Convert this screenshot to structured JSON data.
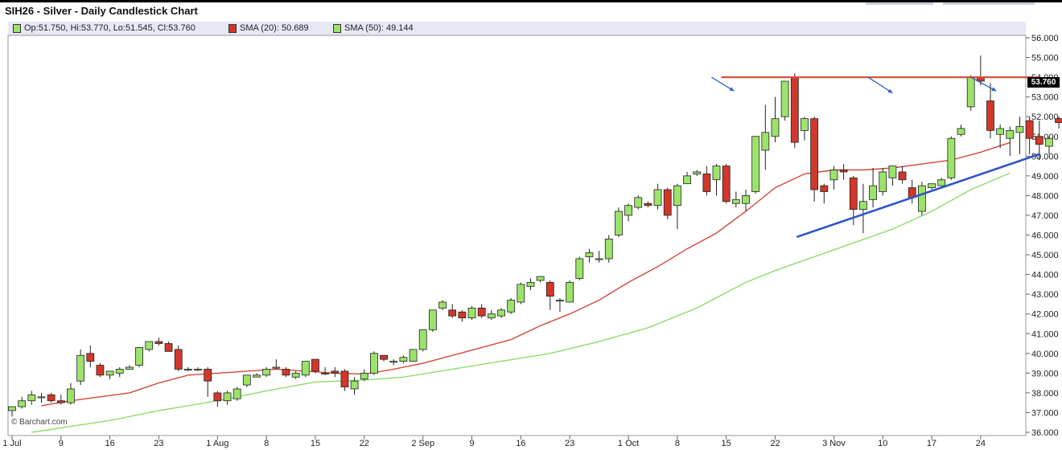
{
  "title": "SIH26 - Silver - Daily Candlestick Chart",
  "legend": {
    "ohlc": "Op:51.750, Hi:53.770, Lo:51.545, Cl:53.760",
    "sma20": "SMA (20): 50.689",
    "sma50": "SMA (50): 49.144"
  },
  "credit": "© Barchart.com",
  "last_price_tag": "53.760",
  "colors": {
    "up": "#9be36a",
    "down": "#d2372b",
    "sma20": "#d24a3a",
    "sma50": "#8edb6a",
    "resistance": "#d2553c",
    "trendline": "#2f55c8",
    "arrow": "#2f5fc0",
    "legend_bg": "#e6e8f6"
  },
  "chart_data": {
    "type": "candlestick",
    "title": "SIH26 - Silver - Daily Candlestick Chart",
    "y_tick_labels": [
      "56.000",
      "55.000",
      "54.000",
      "53.000",
      "52.000",
      "51.000",
      "50.000",
      "49.000",
      "48.000",
      "47.000",
      "46.000",
      "45.000",
      "44.000",
      "43.000",
      "42.000",
      "41.000",
      "40.000",
      "39.000",
      "38.000",
      "37.000",
      "36.000"
    ],
    "y_ticks": [
      56,
      55,
      54,
      53,
      52,
      51,
      50,
      49,
      48,
      47,
      46,
      45,
      44,
      43,
      42,
      41,
      40,
      39,
      38,
      37,
      36
    ],
    "ylim": [
      36,
      56.3
    ],
    "x_labels": [
      {
        "i": 0,
        "label": "1 Jul"
      },
      {
        "i": 5,
        "label": "9"
      },
      {
        "i": 10,
        "label": "16"
      },
      {
        "i": 15,
        "label": "23"
      },
      {
        "i": 21,
        "label": "1 Aug"
      },
      {
        "i": 26,
        "label": "8"
      },
      {
        "i": 31,
        "label": "15"
      },
      {
        "i": 36,
        "label": "22"
      },
      {
        "i": 42,
        "label": "2 Sep"
      },
      {
        "i": 47,
        "label": "9"
      },
      {
        "i": 52,
        "label": "16"
      },
      {
        "i": 57,
        "label": "23"
      },
      {
        "i": 63,
        "label": "1 Oct"
      },
      {
        "i": 68,
        "label": "8"
      },
      {
        "i": 73,
        "label": "15"
      },
      {
        "i": 78,
        "label": "22"
      },
      {
        "i": 84,
        "label": "3 Nov"
      },
      {
        "i": 89,
        "label": "10"
      },
      {
        "i": 94,
        "label": "17"
      },
      {
        "i": 99,
        "label": "24"
      }
    ],
    "candles": [
      {
        "o": 37.1,
        "h": 37.3,
        "l": 36.8,
        "c": 37.3
      },
      {
        "o": 37.3,
        "h": 37.8,
        "l": 37.2,
        "c": 37.6
      },
      {
        "o": 37.6,
        "h": 38.1,
        "l": 37.4,
        "c": 37.9
      },
      {
        "o": 37.8,
        "h": 38.0,
        "l": 37.5,
        "c": 37.8
      },
      {
        "o": 37.9,
        "h": 38.0,
        "l": 37.5,
        "c": 37.6
      },
      {
        "o": 37.6,
        "h": 37.9,
        "l": 37.4,
        "c": 37.5
      },
      {
        "o": 37.5,
        "h": 38.5,
        "l": 37.4,
        "c": 38.2
      },
      {
        "o": 38.6,
        "h": 40.2,
        "l": 38.4,
        "c": 39.9
      },
      {
        "o": 40.0,
        "h": 40.4,
        "l": 39.3,
        "c": 39.6
      },
      {
        "o": 39.4,
        "h": 39.5,
        "l": 38.8,
        "c": 38.9
      },
      {
        "o": 38.9,
        "h": 39.1,
        "l": 38.7,
        "c": 39.1
      },
      {
        "o": 39.0,
        "h": 39.3,
        "l": 38.8,
        "c": 39.2
      },
      {
        "o": 39.2,
        "h": 39.4,
        "l": 39.2,
        "c": 39.3
      },
      {
        "o": 39.4,
        "h": 40.3,
        "l": 39.3,
        "c": 40.3
      },
      {
        "o": 40.2,
        "h": 40.6,
        "l": 40.1,
        "c": 40.6
      },
      {
        "o": 40.6,
        "h": 40.8,
        "l": 40.4,
        "c": 40.5
      },
      {
        "o": 40.5,
        "h": 40.6,
        "l": 40.1,
        "c": 40.1
      },
      {
        "o": 40.2,
        "h": 40.4,
        "l": 39.1,
        "c": 39.2
      },
      {
        "o": 39.2,
        "h": 39.3,
        "l": 39.1,
        "c": 39.2
      },
      {
        "o": 39.2,
        "h": 39.3,
        "l": 39.1,
        "c": 39.2
      },
      {
        "o": 39.2,
        "h": 39.3,
        "l": 37.8,
        "c": 38.6
      },
      {
        "o": 38.0,
        "h": 38.1,
        "l": 37.3,
        "c": 37.6
      },
      {
        "o": 37.6,
        "h": 38.1,
        "l": 37.4,
        "c": 38.0
      },
      {
        "o": 37.7,
        "h": 38.3,
        "l": 37.6,
        "c": 38.2
      },
      {
        "o": 38.4,
        "h": 38.9,
        "l": 38.3,
        "c": 38.9
      },
      {
        "o": 38.8,
        "h": 39.0,
        "l": 38.8,
        "c": 38.9
      },
      {
        "o": 38.9,
        "h": 39.3,
        "l": 38.8,
        "c": 39.2
      },
      {
        "o": 39.3,
        "h": 39.7,
        "l": 39.2,
        "c": 39.3
      },
      {
        "o": 39.2,
        "h": 39.3,
        "l": 38.8,
        "c": 38.9
      },
      {
        "o": 38.8,
        "h": 39.1,
        "l": 38.7,
        "c": 39.0
      },
      {
        "o": 38.9,
        "h": 39.6,
        "l": 38.8,
        "c": 39.6
      },
      {
        "o": 39.7,
        "h": 39.7,
        "l": 39.0,
        "c": 39.1
      },
      {
        "o": 39.0,
        "h": 39.3,
        "l": 38.9,
        "c": 39.0
      },
      {
        "o": 39.1,
        "h": 39.3,
        "l": 38.8,
        "c": 39.0
      },
      {
        "o": 39.1,
        "h": 39.2,
        "l": 38.1,
        "c": 38.3
      },
      {
        "o": 38.2,
        "h": 38.8,
        "l": 37.9,
        "c": 38.6
      },
      {
        "o": 38.7,
        "h": 39.2,
        "l": 38.6,
        "c": 39.0
      },
      {
        "o": 39.0,
        "h": 40.1,
        "l": 38.9,
        "c": 40.0
      },
      {
        "o": 39.9,
        "h": 39.9,
        "l": 39.6,
        "c": 39.7
      },
      {
        "o": 39.6,
        "h": 39.7,
        "l": 39.4,
        "c": 39.6
      },
      {
        "o": 39.6,
        "h": 39.9,
        "l": 39.5,
        "c": 39.8
      },
      {
        "o": 39.6,
        "h": 40.2,
        "l": 39.6,
        "c": 40.2
      },
      {
        "o": 40.2,
        "h": 41.2,
        "l": 40.1,
        "c": 41.2
      },
      {
        "o": 41.2,
        "h": 42.2,
        "l": 41.1,
        "c": 42.2
      },
      {
        "o": 42.3,
        "h": 42.7,
        "l": 42.2,
        "c": 42.6
      },
      {
        "o": 42.2,
        "h": 42.5,
        "l": 41.8,
        "c": 41.9
      },
      {
        "o": 42.1,
        "h": 42.2,
        "l": 41.6,
        "c": 41.8
      },
      {
        "o": 41.8,
        "h": 42.4,
        "l": 41.7,
        "c": 42.3
      },
      {
        "o": 42.3,
        "h": 42.5,
        "l": 41.8,
        "c": 41.9
      },
      {
        "o": 41.8,
        "h": 42.2,
        "l": 41.7,
        "c": 42.0
      },
      {
        "o": 41.9,
        "h": 42.3,
        "l": 41.8,
        "c": 42.2
      },
      {
        "o": 42.1,
        "h": 42.8,
        "l": 42.0,
        "c": 42.7
      },
      {
        "o": 42.6,
        "h": 43.6,
        "l": 42.5,
        "c": 43.5
      },
      {
        "o": 43.4,
        "h": 43.8,
        "l": 43.2,
        "c": 43.6
      },
      {
        "o": 43.7,
        "h": 43.9,
        "l": 43.6,
        "c": 43.9
      },
      {
        "o": 43.6,
        "h": 43.7,
        "l": 42.2,
        "c": 42.9
      },
      {
        "o": 42.7,
        "h": 42.8,
        "l": 42.1,
        "c": 42.7
      },
      {
        "o": 42.6,
        "h": 43.7,
        "l": 42.6,
        "c": 43.6
      },
      {
        "o": 43.8,
        "h": 44.9,
        "l": 43.7,
        "c": 44.8
      },
      {
        "o": 44.9,
        "h": 45.3,
        "l": 44.6,
        "c": 45.1
      },
      {
        "o": 44.8,
        "h": 45.2,
        "l": 44.6,
        "c": 44.8
      },
      {
        "o": 44.8,
        "h": 46.0,
        "l": 44.6,
        "c": 45.8
      },
      {
        "o": 46.0,
        "h": 47.4,
        "l": 45.9,
        "c": 47.2
      },
      {
        "o": 47.0,
        "h": 47.6,
        "l": 46.7,
        "c": 47.5
      },
      {
        "o": 47.4,
        "h": 48.0,
        "l": 47.3,
        "c": 47.9
      },
      {
        "o": 47.6,
        "h": 47.7,
        "l": 47.4,
        "c": 47.5
      },
      {
        "o": 47.5,
        "h": 48.6,
        "l": 47.3,
        "c": 48.3
      },
      {
        "o": 48.3,
        "h": 48.4,
        "l": 46.8,
        "c": 47.0
      },
      {
        "o": 47.5,
        "h": 48.6,
        "l": 46.3,
        "c": 48.5
      },
      {
        "o": 48.6,
        "h": 49.2,
        "l": 48.6,
        "c": 49.0
      },
      {
        "o": 49.1,
        "h": 49.3,
        "l": 49.0,
        "c": 49.2
      },
      {
        "o": 49.1,
        "h": 49.5,
        "l": 48.0,
        "c": 48.2
      },
      {
        "o": 48.8,
        "h": 49.6,
        "l": 48.0,
        "c": 49.5
      },
      {
        "o": 49.5,
        "h": 49.6,
        "l": 47.6,
        "c": 47.7
      },
      {
        "o": 47.6,
        "h": 48.2,
        "l": 47.4,
        "c": 47.8
      },
      {
        "o": 47.6,
        "h": 48.3,
        "l": 47.2,
        "c": 48.0
      },
      {
        "o": 48.2,
        "h": 51.0,
        "l": 48.1,
        "c": 51.0
      },
      {
        "o": 50.3,
        "h": 52.6,
        "l": 49.3,
        "c": 51.2
      },
      {
        "o": 51.0,
        "h": 53.0,
        "l": 50.7,
        "c": 51.9
      },
      {
        "o": 52.0,
        "h": 53.8,
        "l": 51.8,
        "c": 53.8
      },
      {
        "o": 54.0,
        "h": 54.2,
        "l": 50.4,
        "c": 50.7
      },
      {
        "o": 51.3,
        "h": 52.0,
        "l": 50.8,
        "c": 51.9
      },
      {
        "o": 51.9,
        "h": 52.0,
        "l": 47.7,
        "c": 48.3
      },
      {
        "o": 48.5,
        "h": 48.6,
        "l": 47.6,
        "c": 48.2
      },
      {
        "o": 48.8,
        "h": 49.5,
        "l": 48.3,
        "c": 49.3
      },
      {
        "o": 49.3,
        "h": 49.6,
        "l": 48.8,
        "c": 49.2
      },
      {
        "o": 48.9,
        "h": 49.0,
        "l": 46.5,
        "c": 47.3
      },
      {
        "o": 47.3,
        "h": 48.6,
        "l": 46.1,
        "c": 47.7
      },
      {
        "o": 47.8,
        "h": 49.4,
        "l": 47.4,
        "c": 48.5
      },
      {
        "o": 48.2,
        "h": 49.4,
        "l": 48.0,
        "c": 49.2
      },
      {
        "o": 48.9,
        "h": 49.4,
        "l": 48.5,
        "c": 49.5
      },
      {
        "o": 49.2,
        "h": 49.5,
        "l": 48.6,
        "c": 48.8
      },
      {
        "o": 48.4,
        "h": 48.8,
        "l": 47.6,
        "c": 47.9
      },
      {
        "o": 47.2,
        "h": 48.7,
        "l": 47.0,
        "c": 48.5
      },
      {
        "o": 48.4,
        "h": 48.6,
        "l": 48.3,
        "c": 48.6
      },
      {
        "o": 48.5,
        "h": 48.9,
        "l": 48.5,
        "c": 48.8
      },
      {
        "o": 48.9,
        "h": 51.0,
        "l": 48.8,
        "c": 50.9
      },
      {
        "o": 51.1,
        "h": 51.6,
        "l": 51.0,
        "c": 51.4
      },
      {
        "o": 52.5,
        "h": 54.1,
        "l": 52.3,
        "c": 54.0
      },
      {
        "o": 54.0,
        "h": 55.1,
        "l": 53.6,
        "c": 53.8
      },
      {
        "o": 52.8,
        "h": 53.7,
        "l": 50.9,
        "c": 51.3
      },
      {
        "o": 51.1,
        "h": 51.6,
        "l": 50.4,
        "c": 51.4
      },
      {
        "o": 50.9,
        "h": 51.5,
        "l": 50.0,
        "c": 51.3
      },
      {
        "o": 51.2,
        "h": 52.0,
        "l": 50.1,
        "c": 51.5
      },
      {
        "o": 51.8,
        "h": 52.0,
        "l": 50.1,
        "c": 50.9
      },
      {
        "o": 51.0,
        "h": 51.8,
        "l": 49.8,
        "c": 50.6
      },
      {
        "o": 50.5,
        "h": 51.0,
        "l": 50.1,
        "c": 50.9
      },
      {
        "o": 51.9,
        "h": 52.0,
        "l": 51.4,
        "c": 51.7
      },
      {
        "o": 51.75,
        "h": 53.77,
        "l": 51.545,
        "c": 53.76
      }
    ],
    "sma20": [
      {
        "i": 3,
        "v": 37.35
      },
      {
        "i": 6,
        "v": 37.6
      },
      {
        "i": 9,
        "v": 37.8
      },
      {
        "i": 12,
        "v": 38.0
      },
      {
        "i": 15,
        "v": 38.5
      },
      {
        "i": 18,
        "v": 38.9
      },
      {
        "i": 21,
        "v": 39.0
      },
      {
        "i": 24,
        "v": 39.1
      },
      {
        "i": 27,
        "v": 39.2
      },
      {
        "i": 30,
        "v": 39.1
      },
      {
        "i": 33,
        "v": 39.0
      },
      {
        "i": 36,
        "v": 38.95
      },
      {
        "i": 39,
        "v": 39.2
      },
      {
        "i": 42,
        "v": 39.5
      },
      {
        "i": 45,
        "v": 39.9
      },
      {
        "i": 48,
        "v": 40.3
      },
      {
        "i": 51,
        "v": 40.7
      },
      {
        "i": 54,
        "v": 41.4
      },
      {
        "i": 57,
        "v": 42.0
      },
      {
        "i": 60,
        "v": 42.7
      },
      {
        "i": 63,
        "v": 43.6
      },
      {
        "i": 66,
        "v": 44.4
      },
      {
        "i": 69,
        "v": 45.3
      },
      {
        "i": 72,
        "v": 46.1
      },
      {
        "i": 75,
        "v": 47.2
      },
      {
        "i": 78,
        "v": 48.4
      },
      {
        "i": 81,
        "v": 49.1
      },
      {
        "i": 84,
        "v": 49.3
      },
      {
        "i": 87,
        "v": 49.3
      },
      {
        "i": 90,
        "v": 49.4
      },
      {
        "i": 93,
        "v": 49.6
      },
      {
        "i": 96,
        "v": 49.8
      },
      {
        "i": 99,
        "v": 50.2
      },
      {
        "i": 102,
        "v": 50.69
      }
    ],
    "sma50": [
      {
        "i": 2,
        "v": 36.0
      },
      {
        "i": 6,
        "v": 36.3
      },
      {
        "i": 10,
        "v": 36.6
      },
      {
        "i": 15,
        "v": 37.1
      },
      {
        "i": 21,
        "v": 37.6
      },
      {
        "i": 26,
        "v": 38.1
      },
      {
        "i": 31,
        "v": 38.55
      },
      {
        "i": 36,
        "v": 38.65
      },
      {
        "i": 40,
        "v": 38.8
      },
      {
        "i": 45,
        "v": 39.2
      },
      {
        "i": 50,
        "v": 39.6
      },
      {
        "i": 55,
        "v": 40.0
      },
      {
        "i": 60,
        "v": 40.6
      },
      {
        "i": 65,
        "v": 41.3
      },
      {
        "i": 70,
        "v": 42.3
      },
      {
        "i": 75,
        "v": 43.6
      },
      {
        "i": 78,
        "v": 44.2
      },
      {
        "i": 82,
        "v": 44.9
      },
      {
        "i": 86,
        "v": 45.6
      },
      {
        "i": 90,
        "v": 46.3
      },
      {
        "i": 94,
        "v": 47.2
      },
      {
        "i": 98,
        "v": 48.3
      },
      {
        "i": 102,
        "v": 49.14
      }
    ],
    "annotations": {
      "resistance_y": 54.0,
      "resistance_range_i": [
        72.5,
        105
      ],
      "trendline": [
        {
          "i": 80.2,
          "v": 45.9
        },
        {
          "i": 105,
          "v": 50.1
        }
      ],
      "arrows": [
        {
          "from": {
            "i": 71.5,
            "v": 54.0
          },
          "to": {
            "i": 73.8,
            "v": 53.3
          }
        },
        {
          "from": {
            "i": 87.5,
            "v": 54.0
          },
          "to": {
            "i": 90.0,
            "v": 53.2
          }
        },
        {
          "from": {
            "i": 98.0,
            "v": 54.0
          },
          "to": {
            "i": 100.6,
            "v": 53.3
          }
        }
      ]
    }
  }
}
